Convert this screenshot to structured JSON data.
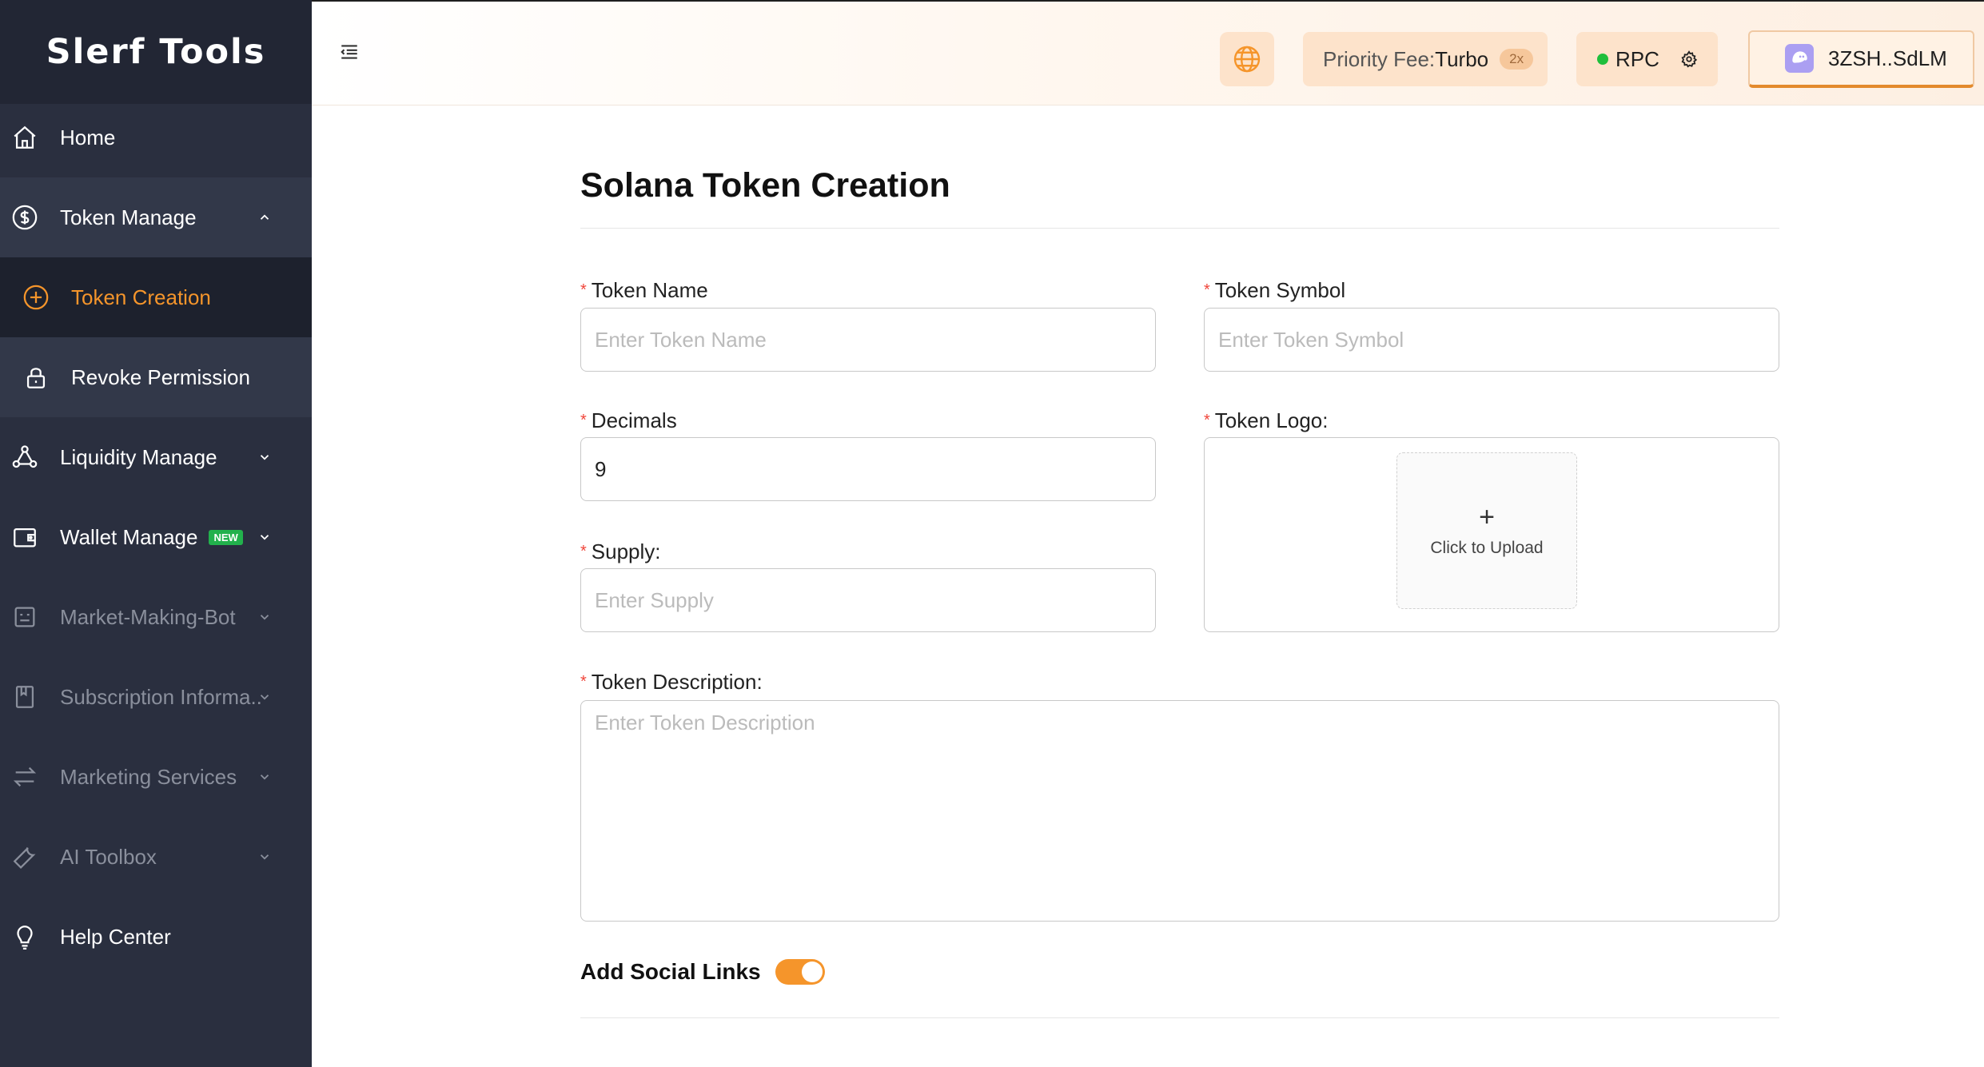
{
  "app": {
    "logo_text": "Slerf Tools"
  },
  "sidebar": {
    "items": [
      {
        "label": "Home",
        "icon": "home-icon"
      },
      {
        "label": "Token Manage",
        "icon": "dollar-circle-icon"
      },
      {
        "label": "Token Creation",
        "icon": "plus-circle-icon"
      },
      {
        "label": "Revoke Permission",
        "icon": "lock-icon"
      },
      {
        "label": "Liquidity Manage",
        "icon": "network-icon"
      },
      {
        "label": "Wallet Manage",
        "icon": "wallet-icon",
        "badge": "NEW"
      },
      {
        "label": "Market-Making-Bot",
        "icon": "bot-icon"
      },
      {
        "label": "Subscription Informa..",
        "icon": "book-icon"
      },
      {
        "label": "Marketing Services",
        "icon": "swap-icon"
      },
      {
        "label": "AI Toolbox",
        "icon": "wrench-icon"
      },
      {
        "label": "Help Center",
        "icon": "lightbulb-icon"
      }
    ]
  },
  "header": {
    "priority_fee_label": "Priority Fee:",
    "priority_fee_value": "Turbo",
    "priority_fee_multiplier": "2x",
    "rpc_label": "RPC",
    "wallet_address": "3ZSH..SdLM",
    "accent_color": "#f5952b"
  },
  "form": {
    "title": "Solana Token Creation",
    "token_name": {
      "label": "Token Name",
      "placeholder": "Enter Token Name"
    },
    "token_symbol": {
      "label": "Token Symbol",
      "placeholder": "Enter Token Symbol"
    },
    "decimals": {
      "label": "Decimals",
      "value": "9"
    },
    "token_logo": {
      "label": "Token Logo:",
      "upload_text": "Click to Upload",
      "plus": "+"
    },
    "supply": {
      "label": "Supply:",
      "placeholder": "Enter Supply"
    },
    "description": {
      "label": "Token Description:",
      "placeholder": "Enter Token Description"
    },
    "social_links": {
      "label": "Add Social Links",
      "enabled": true
    },
    "required_mark": "*"
  }
}
